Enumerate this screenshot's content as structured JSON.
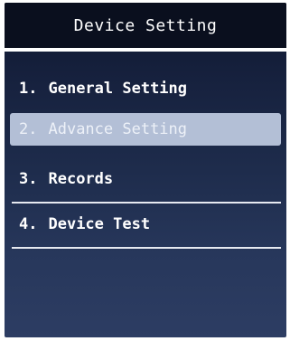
{
  "header": {
    "title": "Device Setting"
  },
  "menu": {
    "items": [
      {
        "number": "1.",
        "label": "General Setting",
        "selected": false
      },
      {
        "number": "2.",
        "label": "Advance Setting",
        "selected": true
      },
      {
        "number": "3.",
        "label": "Records",
        "selected": false
      },
      {
        "number": "4.",
        "label": "Device Test",
        "selected": false
      }
    ]
  },
  "colors": {
    "screen_background": "#1e2c4c",
    "title_bar_background": "#0a0f1e",
    "selected_highlight": "#b3bfd6",
    "text": "#ffffff"
  }
}
